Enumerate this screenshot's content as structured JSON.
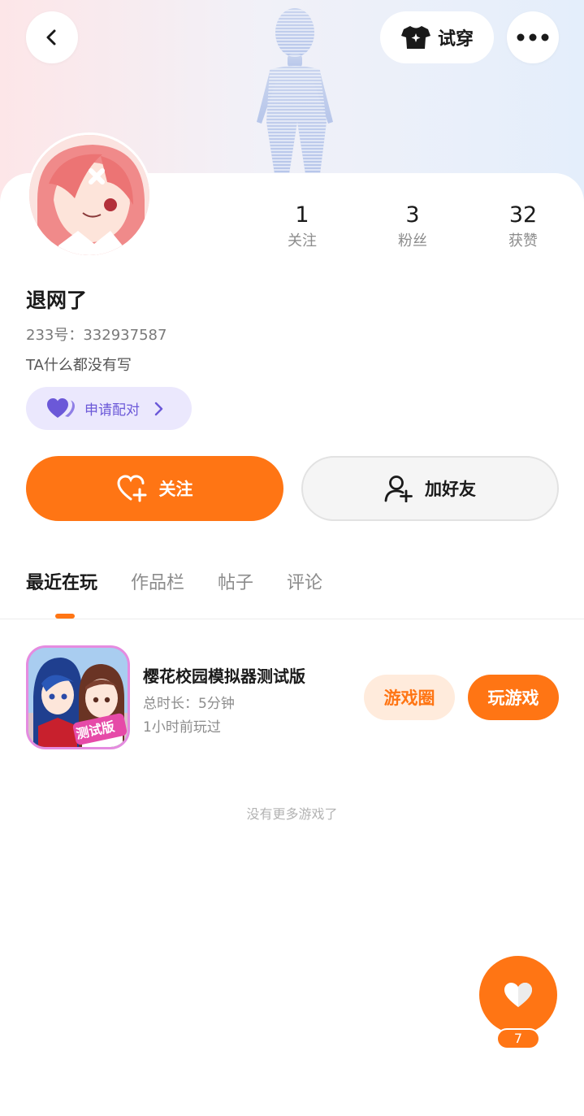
{
  "header": {
    "try_on_label": "试穿",
    "icons": {
      "back": "chevron-left-icon",
      "try_on": "shirt-icon",
      "more": "more-dots-icon"
    }
  },
  "profile": {
    "username": "退网了",
    "id_text": "233号：332937587",
    "bio": "TA什么都没有写",
    "stats": [
      {
        "value": "1",
        "label": "关注"
      },
      {
        "value": "3",
        "label": "粉丝"
      },
      {
        "value": "32",
        "label": "获赞"
      }
    ],
    "pair_button_label": "申请配对"
  },
  "actions": {
    "follow_label": "关注",
    "add_friend_label": "加好友"
  },
  "tabs": [
    {
      "label": "最近在玩",
      "active": true
    },
    {
      "label": "作品栏",
      "active": false
    },
    {
      "label": "帖子",
      "active": false
    },
    {
      "label": "评论",
      "active": false
    }
  ],
  "recent_games": [
    {
      "title": "樱花校园模拟器测试版",
      "duration": "总时长：5分钟",
      "last_played": "1小时前玩过",
      "icon_badge": "测试版",
      "circle_label": "游戏圈",
      "play_label": "玩游戏"
    }
  ],
  "no_more_text": "没有更多游戏了",
  "like_fab": {
    "count": "7"
  },
  "colors": {
    "accent": "#ff7514",
    "pair_bg": "#ebe8fd",
    "pair_text": "#6b58d8",
    "circle_bg": "#ffebdc"
  }
}
